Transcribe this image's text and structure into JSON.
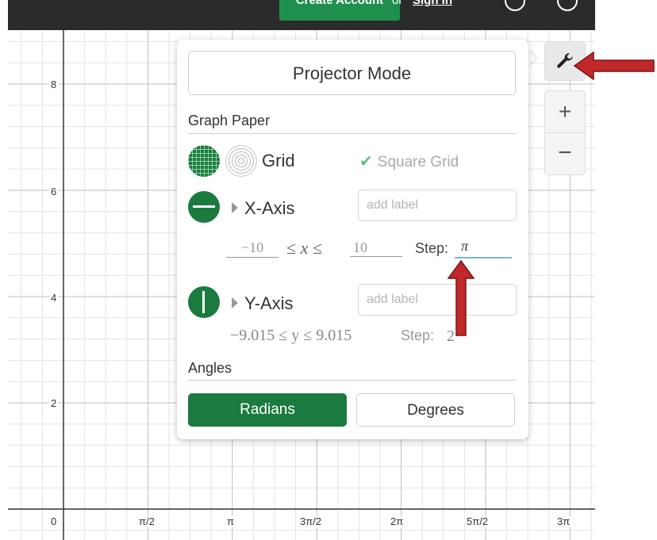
{
  "header": {
    "create_account_label": "Create Account",
    "or_label": "or",
    "sign_in_label": "Sign In"
  },
  "graph": {
    "y_labels": [
      "8",
      "6",
      "4",
      "2",
      "0"
    ],
    "x_labels": [
      "π/2",
      "π",
      "3π/2",
      "2π",
      "5π/2",
      "3π"
    ]
  },
  "settings": {
    "projector_mode_label": "Projector Mode",
    "graph_paper_title": "Graph Paper",
    "grid_label": "Grid",
    "square_grid_label": "Square Grid",
    "square_grid_checked": true,
    "x_axis": {
      "label": "X-Axis",
      "label_placeholder": "add label",
      "min": "−10",
      "inequality": "≤ x ≤",
      "max": "10",
      "step_label": "Step:",
      "step_value": "π"
    },
    "y_axis": {
      "label": "Y-Axis",
      "label_placeholder": "add label",
      "bounds": "−9.015 ≤ y ≤ 9.015",
      "step_label": "Step:",
      "step_value": "2"
    },
    "angles_title": "Angles",
    "radians_label": "Radians",
    "degrees_label": "Degrees",
    "selected_angle_mode": "Radians"
  },
  "controls": {
    "settings_icon": "wrench-icon",
    "zoom_in_label": "+",
    "zoom_out_label": "−"
  },
  "colors": {
    "accent_green": "#1b7a3e",
    "header_dark": "#2b2b2b",
    "annotation_red": "#c0282a"
  }
}
